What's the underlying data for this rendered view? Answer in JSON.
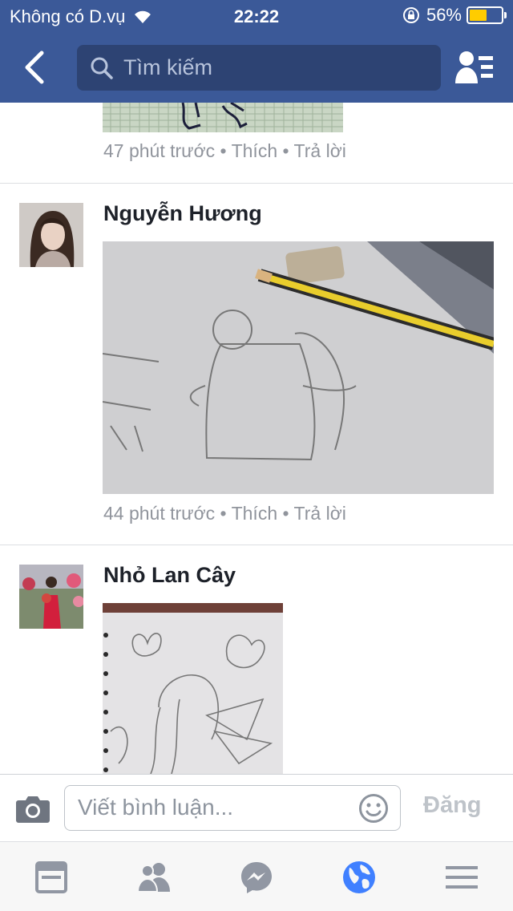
{
  "status_bar": {
    "carrier": "Không có D.vụ",
    "time": "22:22",
    "battery_percent": "56%",
    "battery_level": 0.56,
    "icons": [
      "wifi-icon",
      "rotation-lock-icon",
      "battery-icon"
    ]
  },
  "header": {
    "search_placeholder": "Tìm kiếm",
    "icons": [
      "back-chevron-icon",
      "search-icon",
      "friend-requests-icon"
    ]
  },
  "comments": [
    {
      "name": "",
      "meta": {
        "time": "47 phút trước",
        "sep1": " • ",
        "like": "Thích",
        "sep2": " • ",
        "reply": "Trả lời"
      },
      "photo": "graph-paper-drawing"
    },
    {
      "name": "Nguyễn Hương",
      "meta": {
        "time": "44 phút trước",
        "sep1": " • ",
        "like": "Thích",
        "sep2": " • ",
        "reply": "Trả lời"
      },
      "photo": "pencil-sketch-boy"
    },
    {
      "name": "Nhỏ Lan Cây",
      "meta": null,
      "photo": "sketchbook-fairy-drawing"
    }
  ],
  "composer": {
    "placeholder": "Viết bình luận...",
    "post_label": "Đăng",
    "icons": [
      "camera-icon",
      "emoji-icon"
    ]
  },
  "tabbar": {
    "tabs": [
      "news-feed-icon",
      "friends-icon",
      "messenger-icon",
      "notifications-globe-icon",
      "menu-icon"
    ],
    "active_tab": "notifications-globe-icon",
    "colors": {
      "inactive": "#9197a3",
      "active": "#4080ff"
    }
  },
  "colors": {
    "brand": "#3b5998",
    "search_bg": "#2d4373",
    "meta_text": "#90949c"
  }
}
